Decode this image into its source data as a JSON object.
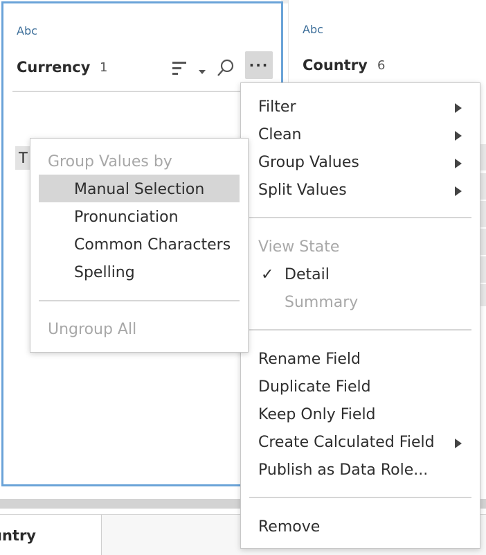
{
  "left_card": {
    "type_label": "Abc",
    "field_name": "Currency",
    "field_count": "1",
    "more_label": "···",
    "partial_value": "T"
  },
  "right_card": {
    "type_label": "Abc",
    "field_name": "Country",
    "field_count": "6"
  },
  "bottom_tab": {
    "label": "untry"
  },
  "main_menu": {
    "items": [
      {
        "label": "Filter",
        "submenu": true
      },
      {
        "label": "Clean",
        "submenu": true
      },
      {
        "label": "Group Values",
        "submenu": true
      },
      {
        "label": "Split Values",
        "submenu": true
      }
    ],
    "view_state": {
      "heading": "View State",
      "detail": "Detail",
      "summary": "Summary",
      "check": "✓"
    },
    "actions": [
      {
        "label": "Rename Field"
      },
      {
        "label": "Duplicate Field"
      },
      {
        "label": "Keep Only Field"
      },
      {
        "label": "Create Calculated Field",
        "submenu": true
      },
      {
        "label": "Publish as Data Role..."
      }
    ],
    "remove": "Remove"
  },
  "group_menu": {
    "heading": "Group Values by",
    "items": [
      {
        "label": "Manual Selection",
        "highlighted": true
      },
      {
        "label": "Pronunciation"
      },
      {
        "label": "Common Characters"
      },
      {
        "label": "Spelling"
      }
    ],
    "ungroup": "Ungroup All"
  }
}
